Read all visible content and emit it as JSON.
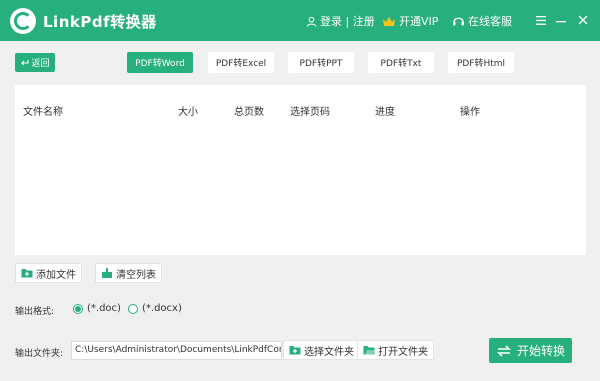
{
  "app": {
    "title": "LinkPdf转换器"
  },
  "titlebar": {
    "login_label": "登录 | 注册",
    "vip_label": "开通VIP",
    "service_label": "在线客服"
  },
  "toolbar": {
    "back_label": "返回",
    "tabs": [
      {
        "label": "PDF转Word",
        "active": true
      },
      {
        "label": "PDF转Excel",
        "active": false
      },
      {
        "label": "PDF转PPT",
        "active": false
      },
      {
        "label": "PDF转Txt",
        "active": false
      },
      {
        "label": "PDF转Html",
        "active": false
      }
    ]
  },
  "table": {
    "columns": [
      "文件名称",
      "大小",
      "总页数",
      "选择页码",
      "进度",
      "操作"
    ],
    "rows": []
  },
  "actions": {
    "add_file": "添加文件",
    "clear_list": "清空列表"
  },
  "output": {
    "format_label": "输出格式:",
    "formats": [
      {
        "label": "(*.doc)",
        "checked": true
      },
      {
        "label": "(*.docx)",
        "checked": false
      }
    ],
    "folder_label": "输出文件夹:",
    "folder_path": "C:\\Users\\Administrator\\Documents\\LinkPdfConvert",
    "select_folder": "选择文件夹",
    "open_folder": "打开文件夹",
    "start_label": "开始转换"
  },
  "colors": {
    "accent": "#27b07d",
    "vip_crown": "#f5c518"
  }
}
